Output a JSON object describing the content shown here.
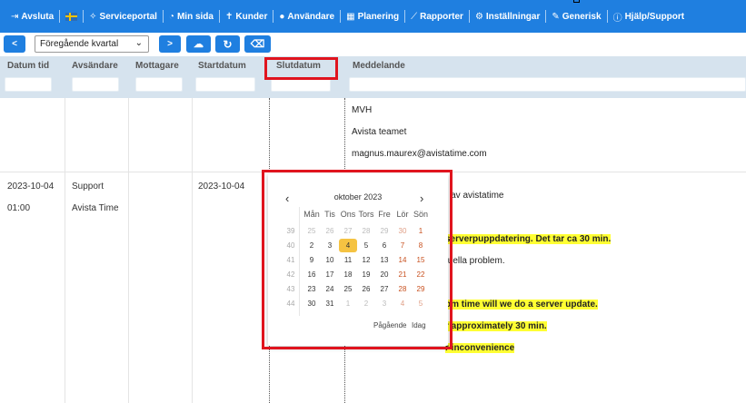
{
  "nav": {
    "items": [
      {
        "icon": "exit-icon",
        "glyph": "⇥",
        "label": "Avsluta"
      },
      {
        "icon": "flag-sweden-icon",
        "glyph": "",
        "label": ""
      },
      {
        "icon": "handshake-icon",
        "glyph": "✧",
        "label": "Serviceportal"
      },
      {
        "icon": "dashboard-icon",
        "glyph": "◔",
        "label": "Min sida"
      },
      {
        "icon": "user-tie-icon",
        "glyph": "✝",
        "label": "Kunder"
      },
      {
        "icon": "user-icon",
        "glyph": "●",
        "label": "Användare"
      },
      {
        "icon": "calendar-icon",
        "glyph": "▦",
        "label": "Planering"
      },
      {
        "icon": "line-chart-icon",
        "glyph": "⟋",
        "label": "Rapporter"
      },
      {
        "icon": "cogs-icon",
        "glyph": "⚙",
        "label": "Inställningar"
      },
      {
        "icon": "wrench-icon",
        "glyph": "✎",
        "label": "Generisk"
      },
      {
        "icon": "info-circle-icon",
        "glyph": "ⓘ",
        "label": "Hjälp/Support"
      }
    ]
  },
  "toolbar": {
    "prev_label": "<",
    "period_value": "Föregående kvartal",
    "next_label": ">",
    "download_glyph": "☁",
    "refresh_glyph": "↻",
    "eraser_glyph": "⌫"
  },
  "table": {
    "columns": [
      "Datum tid",
      "Avsändare",
      "Mottagare",
      "Startdatum",
      "Slutdatum",
      "Meddelande"
    ],
    "row0": {
      "messages": [
        "MVH",
        "Avista teamet",
        "magnus.maurex@avistatime.com"
      ]
    },
    "row1": {
      "date": "2023-10-04",
      "time": "01:00",
      "sender_1": "Support",
      "sender_2": "Avista Time",
      "receiver": "",
      "start": "2023-10-04",
      "msg_visible": [
        {
          "text": "ale av avistatime",
          "highlight": false
        },
        {
          "text": "serverpuppdatering. Det tar ca 30 min.",
          "highlight": true
        },
        {
          "text": "tuella problem.",
          "highlight": false
        },
        {
          "text": "om time will we do a server update.",
          "highlight": true
        },
        {
          "text": "r approximately 30 min.",
          "highlight": true
        },
        {
          "text": "r inconvenience",
          "highlight": true
        }
      ]
    }
  },
  "datepicker": {
    "month_title": "oktober 2023",
    "prev": "‹",
    "next": "›",
    "weekdays": [
      "Mån",
      "Tis",
      "Ons",
      "Tors",
      "Fre",
      "Lör",
      "Sön"
    ],
    "weeks": [
      {
        "wk": "39",
        "days": [
          "25",
          "26",
          "27",
          "28",
          "29",
          "30",
          "1"
        ],
        "other": [
          true,
          true,
          true,
          true,
          true,
          true,
          false
        ]
      },
      {
        "wk": "40",
        "days": [
          "2",
          "3",
          "4",
          "5",
          "6",
          "7",
          "8"
        ],
        "other": [
          false,
          false,
          false,
          false,
          false,
          false,
          false
        ]
      },
      {
        "wk": "41",
        "days": [
          "9",
          "10",
          "11",
          "12",
          "13",
          "14",
          "15"
        ],
        "other": [
          false,
          false,
          false,
          false,
          false,
          false,
          false
        ]
      },
      {
        "wk": "42",
        "days": [
          "16",
          "17",
          "18",
          "19",
          "20",
          "21",
          "22"
        ],
        "other": [
          false,
          false,
          false,
          false,
          false,
          false,
          false
        ]
      },
      {
        "wk": "43",
        "days": [
          "23",
          "24",
          "25",
          "26",
          "27",
          "28",
          "29"
        ],
        "other": [
          false,
          false,
          false,
          false,
          false,
          false,
          false
        ]
      },
      {
        "wk": "44",
        "days": [
          "30",
          "31",
          "1",
          "2",
          "3",
          "4",
          "5"
        ],
        "other": [
          false,
          false,
          true,
          true,
          true,
          true,
          true
        ]
      }
    ],
    "today": "4",
    "footer_ongoing": "Pågående",
    "footer_today": "Idag"
  }
}
